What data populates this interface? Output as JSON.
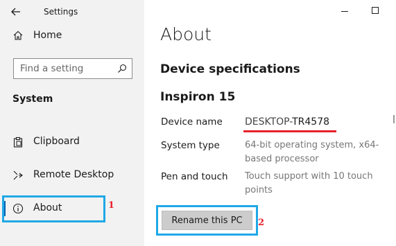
{
  "window": {
    "app_title": "Settings"
  },
  "sidebar": {
    "home_label": "Home",
    "search_placeholder": "Find a setting",
    "section_label": "System",
    "items": [
      {
        "label": "Clipboard",
        "icon": "clipboard-icon"
      },
      {
        "label": "Remote Desktop",
        "icon": "remote-desktop-icon"
      },
      {
        "label": "About",
        "icon": "info-icon",
        "selected": true
      }
    ]
  },
  "main": {
    "page_title": "About",
    "section_title": "Device specifications",
    "device_model": "Inspiron 15",
    "specs": {
      "device_name_label": "Device name",
      "device_name_prefix": "DESKTOP-",
      "device_name_suffix": "TR4578",
      "system_type_label": "System type",
      "system_type_value": "64-bit operating system, x64-based processor",
      "pen_touch_label": "Pen and touch",
      "pen_touch_value": "Touch support with 10 touch points"
    },
    "rename_button_label": "Rename this PC"
  },
  "annotations": {
    "marker_1": "1",
    "marker_2": "2",
    "highlight_color": "#1fa8e6",
    "marker_color": "#e8202a"
  },
  "colors": {
    "accent": "#0063b1",
    "sidebar_bg": "#f2f2f2"
  }
}
